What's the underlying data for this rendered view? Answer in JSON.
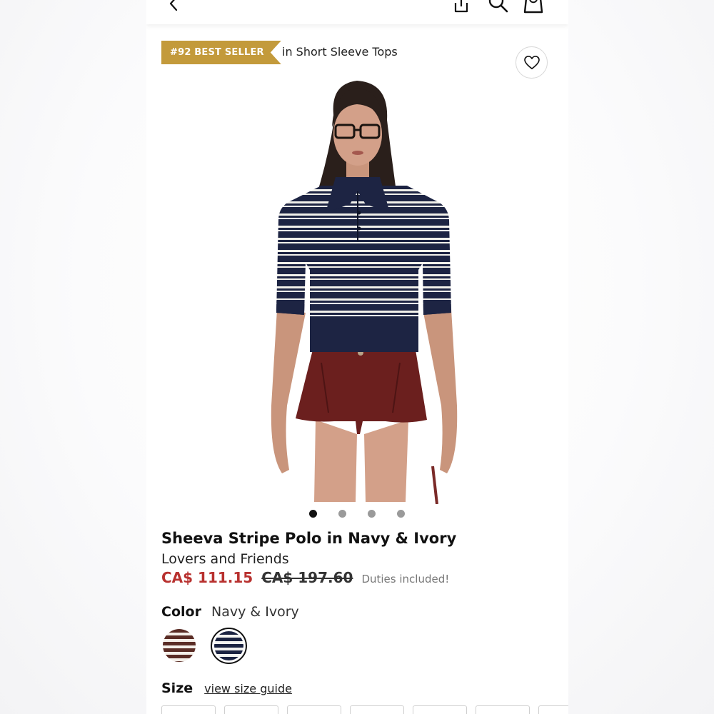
{
  "header": {
    "icons": [
      "chevron-left-icon",
      "share-icon",
      "search-icon",
      "shopping-bag-icon"
    ]
  },
  "badge": {
    "label": "#92 BEST SELLER",
    "context": "in Short Sleeve Tops",
    "color": "#c39a3b"
  },
  "gallery": {
    "wishlist_icon": "heart-icon",
    "image_count": 4,
    "active_index": 0
  },
  "product": {
    "title": "Sheeva Stripe Polo in Navy & Ivory",
    "brand": "Lovers and Friends",
    "price_sale": "CA$ 111.15",
    "price_original": "CA$ 197.60",
    "duties_note": "Duties included!",
    "sale_color": "#b8312f"
  },
  "color": {
    "label": "Color",
    "selected": "Navy & Ivory",
    "swatches": [
      "Brown & Ivory",
      "Navy & Ivory"
    ],
    "selected_index": 1
  },
  "size": {
    "label": "Size",
    "guide_link": "view size guide"
  }
}
